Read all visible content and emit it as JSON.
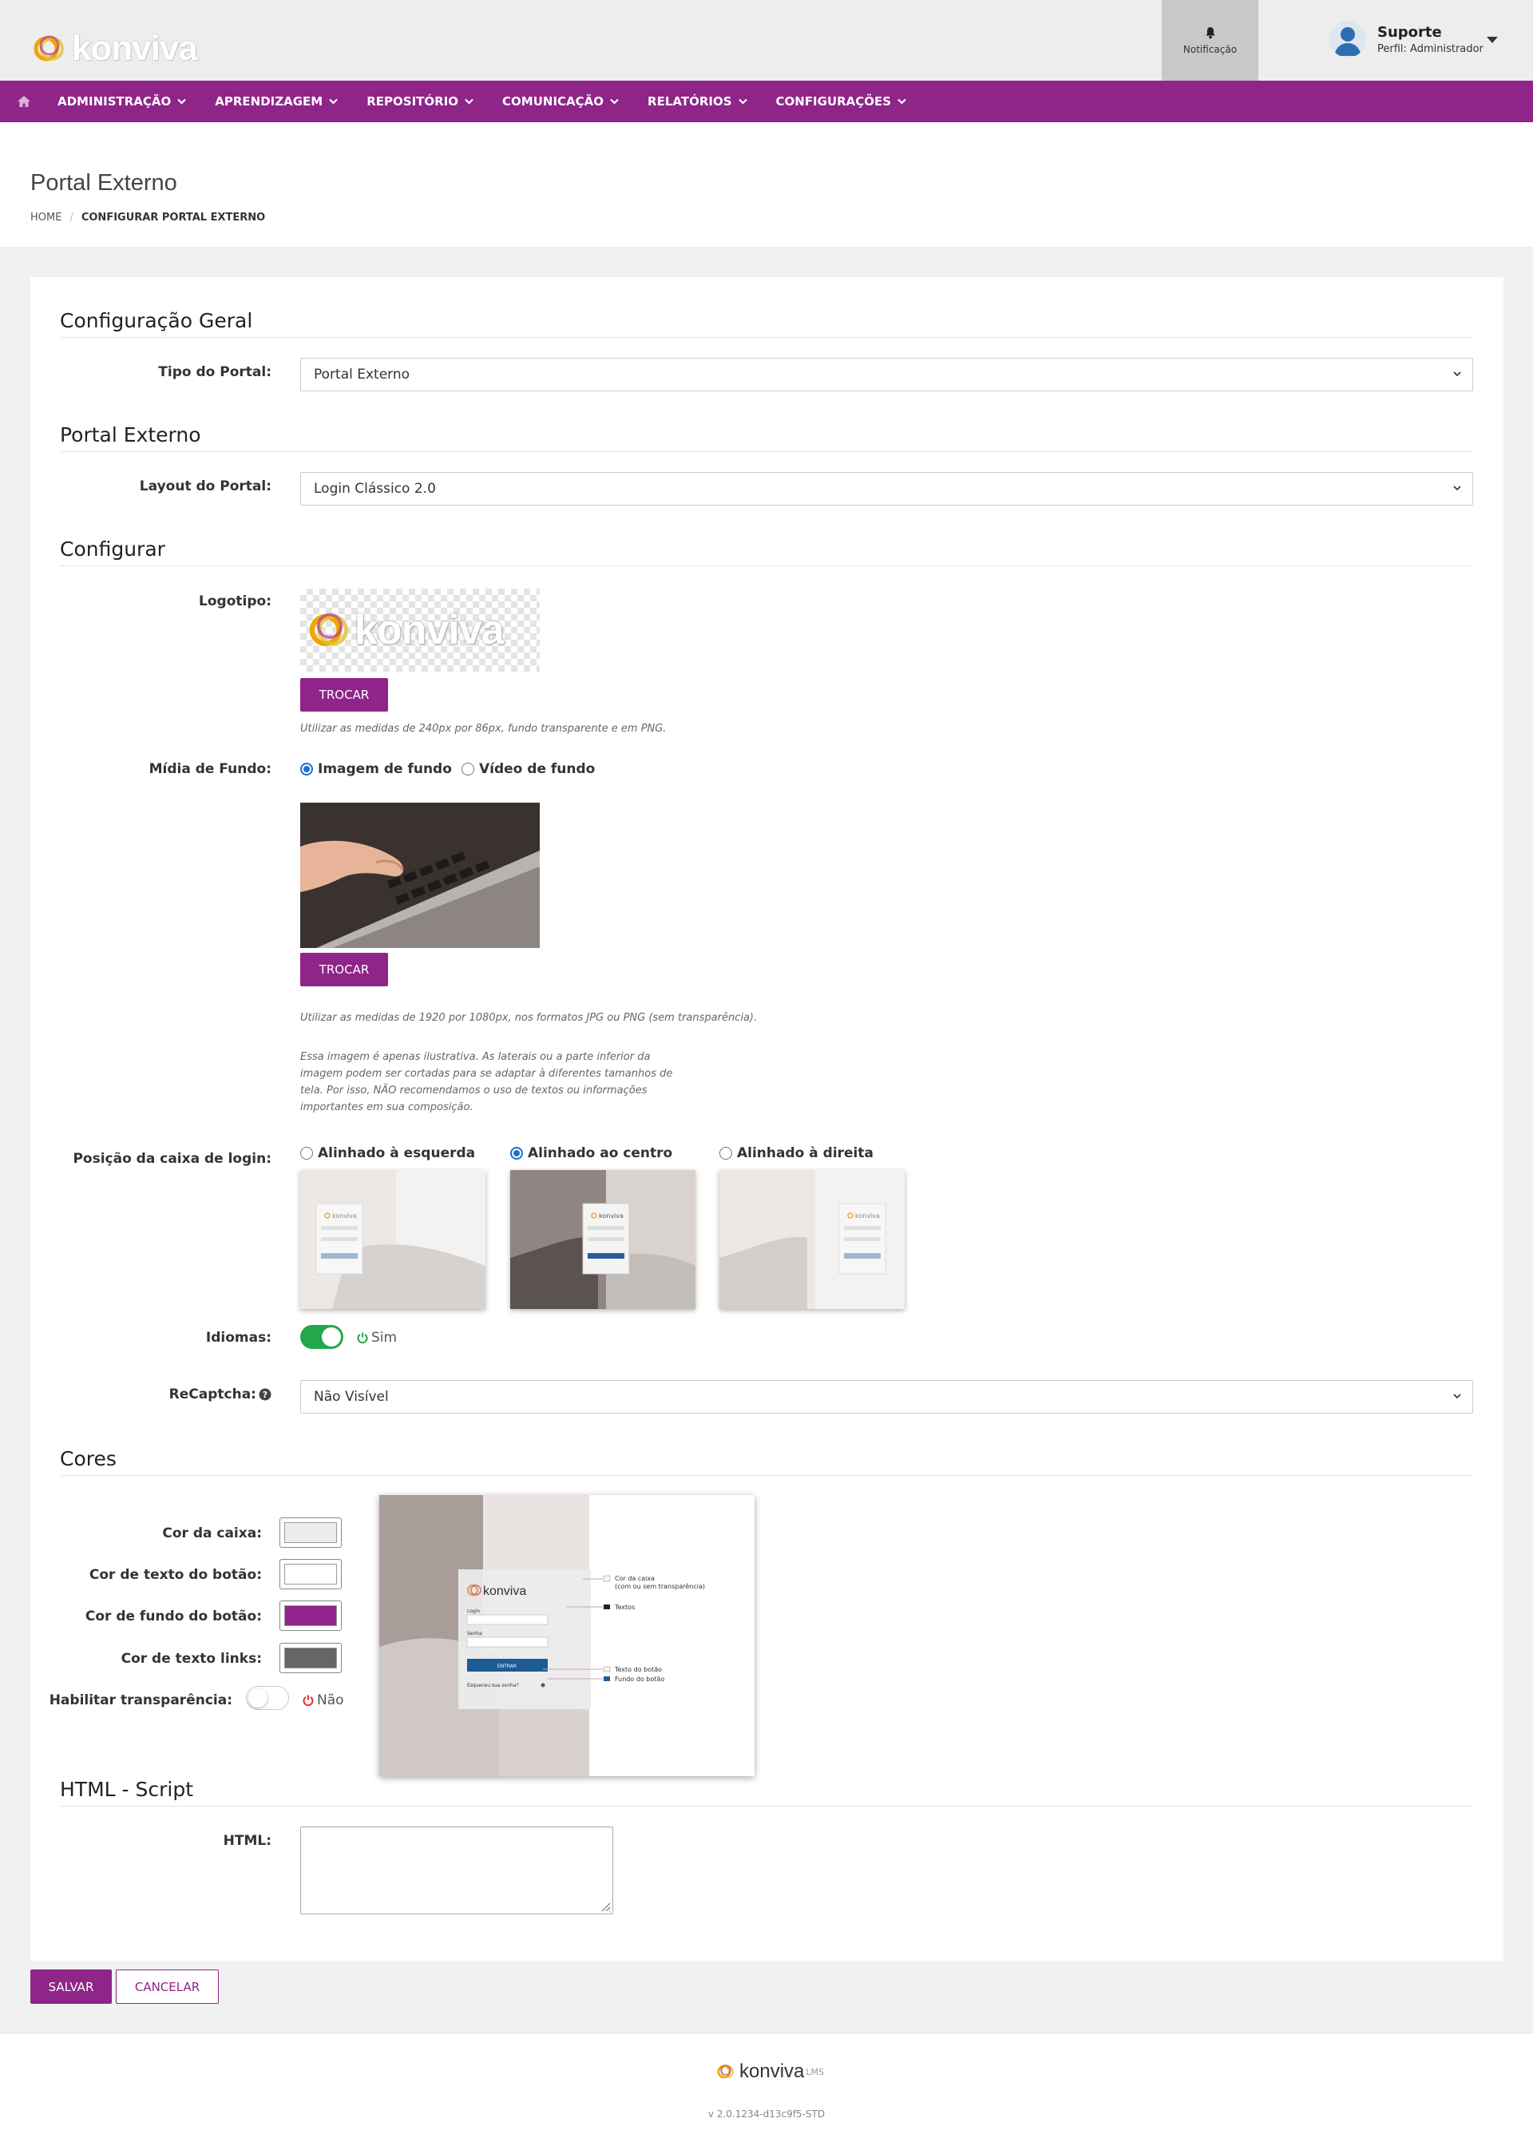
{
  "header": {
    "brand": "konviva",
    "notification_label": "Notificação",
    "user_name": "Suporte",
    "user_role": "Perfil: Administrador"
  },
  "nav": {
    "items": [
      {
        "label": "ADMINISTRAÇÃO"
      },
      {
        "label": "APRENDIZAGEM"
      },
      {
        "label": "REPOSITÓRIO"
      },
      {
        "label": "COMUNICAÇÃO"
      },
      {
        "label": "RELATÓRIOS"
      },
      {
        "label": "CONFIGURAÇÕES"
      }
    ]
  },
  "page": {
    "title": "Portal Externo",
    "breadcrumb_home": "HOME",
    "breadcrumb_sep": "/",
    "breadcrumb_current": "CONFIGURAR PORTAL EXTERNO"
  },
  "general": {
    "section_title": "Configuração Geral",
    "portal_type_label": "Tipo do Portal:",
    "portal_type_value": "Portal Externo"
  },
  "portal": {
    "section_title": "Portal Externo",
    "layout_label": "Layout do Portal:",
    "layout_value": "Login Clássico 2.0"
  },
  "configure": {
    "section_title": "Configurar",
    "logo_label": "Logotipo:",
    "logo_preview_text": "konviva",
    "logo_change": "TROCAR",
    "logo_hint": "Utilizar as medidas de 240px por 86px, fundo transparente e em PNG.",
    "media_label": "Mídia de Fundo:",
    "media_image": "Imagem de fundo",
    "media_video": "Vídeo de fundo",
    "media_change": "TROCAR",
    "media_hint1": "Utilizar as medidas de 1920 por 1080px, nos formatos JPG ou PNG (sem transparência).",
    "media_hint2_l1": "Essa imagem é apenas ilustrativa. As laterais ou a parte inferior da",
    "media_hint2_l2": "imagem podem ser cortadas para se adaptar à diferentes tamanhos de",
    "media_hint2_l3": "tela. Por isso, NÃO recomendamos o uso de textos ou informações",
    "media_hint2_l4": "importantes em sua composição.",
    "position_label": "Posição da caixa de login:",
    "pos_left": "Alinhado à esquerda",
    "pos_center": "Alinhado ao centro",
    "pos_right": "Alinhado à direita",
    "thumb_brand": "konviva",
    "languages_label": "Idiomas:",
    "languages_state": "Sim",
    "recaptcha_label": "ReCaptcha:",
    "recaptcha_value": "Não Visível"
  },
  "colors": {
    "section_title": "Cores",
    "box_color_label": "Cor da caixa:",
    "button_text_label": "Cor de texto do botão:",
    "button_bg_label": "Cor de fundo do botão:",
    "link_text_label": "Cor de texto links:",
    "transparency_label": "Habilitar transparência:",
    "transparency_state": "Não",
    "box_color": "#ececec",
    "button_text_color": "#ffffff",
    "button_bg_color": "#8f2489",
    "link_text_color": "#666666",
    "preview": {
      "brand": "konviva",
      "login_label": "Login",
      "password_label": "Senha",
      "enter_button": "ENTRAR",
      "forgot": "Esqueceu sua senha?",
      "legend_box_l1": "Cor da caixa",
      "legend_box_l2": "(com ou sem transparência)",
      "legend_texts": "Textos",
      "legend_btn_text": "Texto do botão",
      "legend_btn_bg": "Fundo do botão"
    }
  },
  "html_script": {
    "section_title": "HTML - Script",
    "html_label": "HTML:",
    "html_value": ""
  },
  "actions": {
    "save": "SALVAR",
    "cancel": "CANCELAR"
  },
  "footer": {
    "brand": "konviva",
    "brand_sup": "LMS",
    "version": "v 2.0.1234-d13c9f5-STD"
  },
  "theme": {
    "primary": "#8f2489",
    "toggle_on": "#22a84a",
    "toggle_off_text": "#e0302a",
    "radio_selected": "#1a6fd1"
  }
}
